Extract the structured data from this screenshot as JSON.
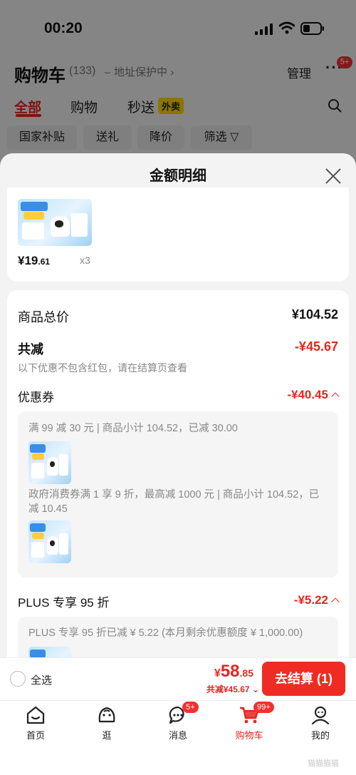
{
  "status_bar": {
    "time": "00:20"
  },
  "cart_header": {
    "title": "购物车",
    "count": "(133)",
    "address_protect": "地址保护中",
    "manage": "管理",
    "more_badge": "5+"
  },
  "tabs": [
    {
      "label": "全部"
    },
    {
      "label": "购物"
    },
    {
      "label": "秒送"
    }
  ],
  "waimai_tag": "外卖",
  "filters": [
    "国家补贴",
    "送礼",
    "降价",
    "筛选"
  ],
  "sheet": {
    "title": "金额明细",
    "item": {
      "price_int": "¥19",
      "price_dec": ".61",
      "qty": "x3"
    },
    "summary": {
      "total_label": "商品总价",
      "total_value": "¥104.52",
      "reduce_label": "共减",
      "reduce_value": "-¥45.67",
      "note": "以下优惠不包含红包，请在结算页查看"
    },
    "coupon": {
      "label": "优惠券",
      "value": "-¥40.45",
      "line1": "满 99 减 30 元 | 商品小计 104.52，已减 30.00",
      "line2": "政府消费券满 1 享 9 折，最高减 1000 元 | 商品小计 104.52，已减 10.45"
    },
    "plus": {
      "label": "PLUS 专享 95 折",
      "value": "-¥5.22",
      "line1": "PLUS 专享 95 折已减 ¥ 5.22 (本月剩余优惠额度 ¥ 1,000.00)"
    }
  },
  "checkout": {
    "select_all": "全选",
    "currency": "¥",
    "total_int": "58",
    "total_dec": ".85",
    "saved": "共减¥45.67",
    "button": "去结算 (1)"
  },
  "tabbar": [
    {
      "label": "首页",
      "icon": "home-icon"
    },
    {
      "label": "逛",
      "icon": "stroll-icon"
    },
    {
      "label": "消息",
      "icon": "message-icon",
      "badge": "5+"
    },
    {
      "label": "购物车",
      "icon": "cart-icon",
      "badge": "99+"
    },
    {
      "label": "我的",
      "icon": "profile-icon"
    }
  ],
  "watermark": "猫猫猫猫",
  "colors": {
    "accent": "#e6261f",
    "pay_button": "#f02b24",
    "waimai": "#ffd500"
  }
}
